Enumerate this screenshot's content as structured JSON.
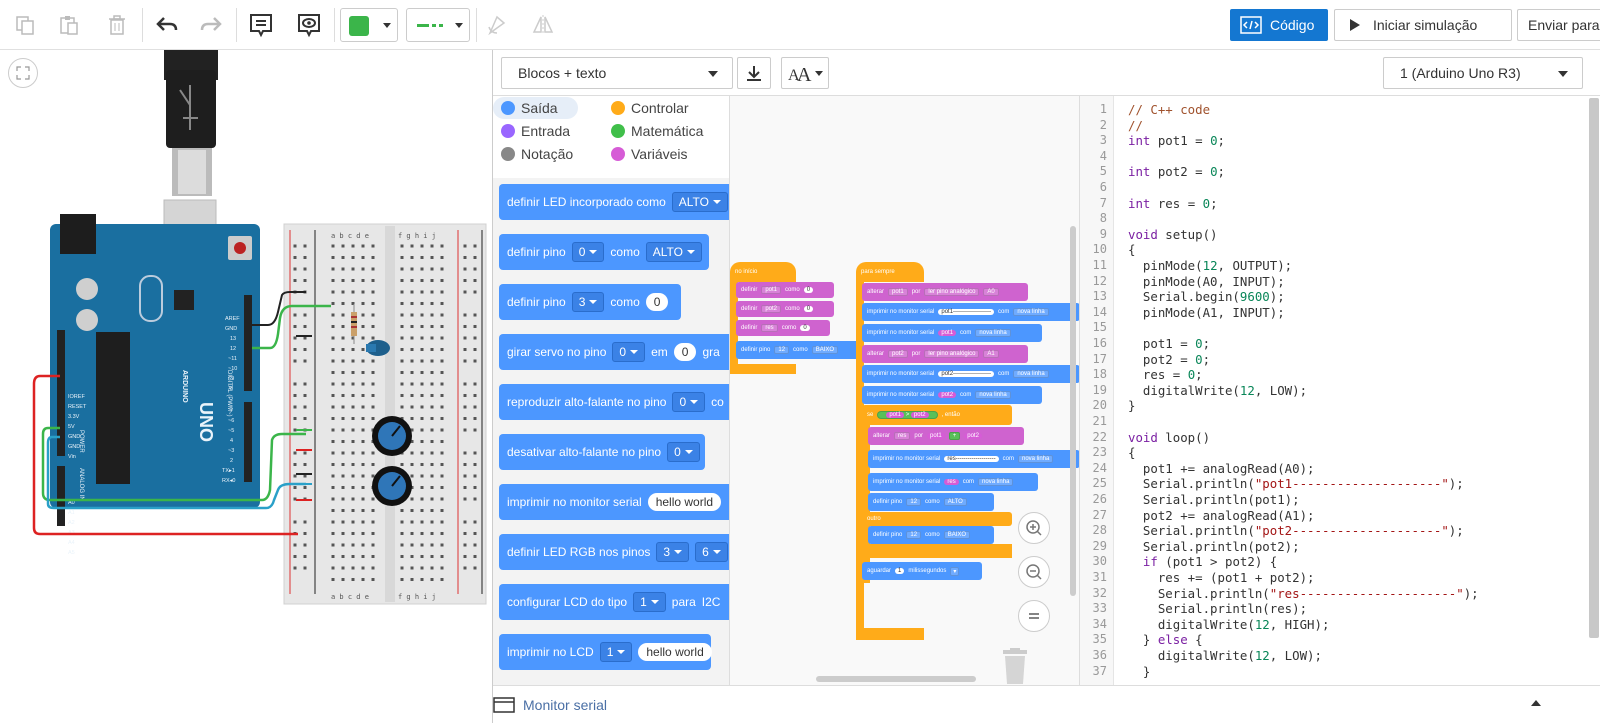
{
  "toolbar": {
    "code_label": "Código",
    "sim_label": "Iniciar simulação",
    "send_label": "Enviar para",
    "color_swatch": "#3bb54a",
    "wire_color": "#3bb54a"
  },
  "editor": {
    "mode": "Blocos + texto",
    "board": "1 (Arduino Uno R3)",
    "serial_label": "Monitor serial"
  },
  "categories": [
    {
      "label": "Saída",
      "color": "#4c97ff"
    },
    {
      "label": "Controlar",
      "color": "#ffab19"
    },
    {
      "label": "Entrada",
      "color": "#9966ff"
    },
    {
      "label": "Matemática",
      "color": "#40bf4a"
    },
    {
      "label": "Notação",
      "color": "#888888"
    },
    {
      "label": "Variáveis",
      "color": "#d65cd6"
    }
  ],
  "palette_blocks": {
    "b1": {
      "text": "definir LED incorporado como",
      "dd": "ALTO"
    },
    "b2": {
      "text": "definir pino",
      "dd1": "0",
      "text2": "como",
      "dd2": "ALTO"
    },
    "b3": {
      "text": "definir pino",
      "dd1": "3",
      "text2": "como",
      "val": "0"
    },
    "b4": {
      "text": "girar servo no pino",
      "dd1": "0",
      "text2": "em",
      "val": "0",
      "text3": "gra"
    },
    "b5": {
      "text": "reproduzir alto-falante no pino",
      "dd1": "0",
      "text2": "co"
    },
    "b6": {
      "text": "desativar alto-falante no pino",
      "dd1": "0"
    },
    "b7": {
      "text": "imprimir no monitor serial",
      "val": "hello world"
    },
    "b8": {
      "text": "definir LED RGB nos pinos",
      "dd1": "3",
      "dd2": "6"
    },
    "b9": {
      "text": "configurar LCD do tipo",
      "dd1": "1",
      "text2": "para",
      "text3": "I2C"
    },
    "b10": {
      "text": "imprimir no LCD",
      "dd1": "1",
      "val": "hello world"
    }
  },
  "workspace": {
    "setup_hat": "no início",
    "loop_hat": "para sempre",
    "s1": {
      "a": "definir",
      "v": "pot1",
      "b": "como",
      "n": "0"
    },
    "s2": {
      "a": "definir",
      "v": "pot2",
      "b": "como",
      "n": "0"
    },
    "s3": {
      "a": "definir",
      "v": "res",
      "b": "como",
      "n": "0"
    },
    "s4": {
      "a": "definir pino",
      "p": "12",
      "b": "como",
      "m": "BAIXO"
    },
    "l1": {
      "a": "alterar",
      "v": "pot1",
      "b": "por",
      "c": "ler pino analógico",
      "d": "A0"
    },
    "l2": {
      "a": "imprimir no monitor serial",
      "v": "pot1-------------------",
      "b": "com",
      "c": "nova linha"
    },
    "l3": {
      "a": "imprimir no monitor serial",
      "v": "pot1",
      "b": "com",
      "c": "nova linha"
    },
    "l4": {
      "a": "alterar",
      "v": "pot2",
      "b": "por",
      "c": "ler pino analógico",
      "d": "A1"
    },
    "l5": {
      "a": "imprimir no monitor serial",
      "v": "pot2-------------------",
      "b": "com",
      "c": "nova linha"
    },
    "l6": {
      "a": "imprimir no monitor serial",
      "v": "pot2",
      "b": "com",
      "c": "nova linha"
    },
    "if": {
      "a": "se",
      "x": "pot1",
      "op": ">",
      "y": "pot2",
      "b": ", então"
    },
    "l7": {
      "a": "alterar",
      "v": "res",
      "b": "por",
      "x": "pot1",
      "op": "+",
      "y": "pot2"
    },
    "l8": {
      "a": "imprimir no monitor serial",
      "v": "res--------------------",
      "b": "com",
      "c": "nova linha"
    },
    "l9": {
      "a": "imprimir no monitor serial",
      "v": "res",
      "b": "com",
      "c": "nova linha"
    },
    "l10": {
      "a": "definir pino",
      "p": "12",
      "b": "como",
      "m": "ALTO"
    },
    "else": "outro",
    "l11": {
      "a": "definir pino",
      "p": "12",
      "b": "como",
      "m": "BAIXO"
    },
    "wait": {
      "a": "aguardar",
      "n": "1",
      "u": "milissegundos"
    }
  },
  "code_lines": [
    "// C++ code",
    "//",
    "int pot1 = 0;",
    "",
    "int pot2 = 0;",
    "",
    "int res = 0;",
    "",
    "void setup()",
    "{",
    "  pinMode(12, OUTPUT);",
    "  pinMode(A0, INPUT);",
    "  Serial.begin(9600);",
    "  pinMode(A1, INPUT);",
    "",
    "  pot1 = 0;",
    "  pot2 = 0;",
    "  res = 0;",
    "  digitalWrite(12, LOW);",
    "}",
    "",
    "void loop()",
    "{",
    "  pot1 += analogRead(A0);",
    "  Serial.println(\"pot1--------------------\");",
    "  Serial.println(pot1);",
    "  pot2 += analogRead(A1);",
    "  Serial.println(\"pot2--------------------\");",
    "  Serial.println(pot2);",
    "  if (pot1 > pot2) {",
    "    res += (pot1 + pot2);",
    "    Serial.println(\"res---------------------\");",
    "    Serial.println(res);",
    "    digitalWrite(12, HIGH);",
    "  } else {",
    "    digitalWrite(12, LOW);",
    "  }"
  ],
  "circuit": {
    "board_name": "UNO",
    "board_brand": "ARDUINO",
    "power_label": "POWER",
    "analog_label": "ANALOG IN",
    "digital_label": "DIGITAL (PWM~)",
    "breadboard_cols": "a b c d e   f g h i j"
  }
}
